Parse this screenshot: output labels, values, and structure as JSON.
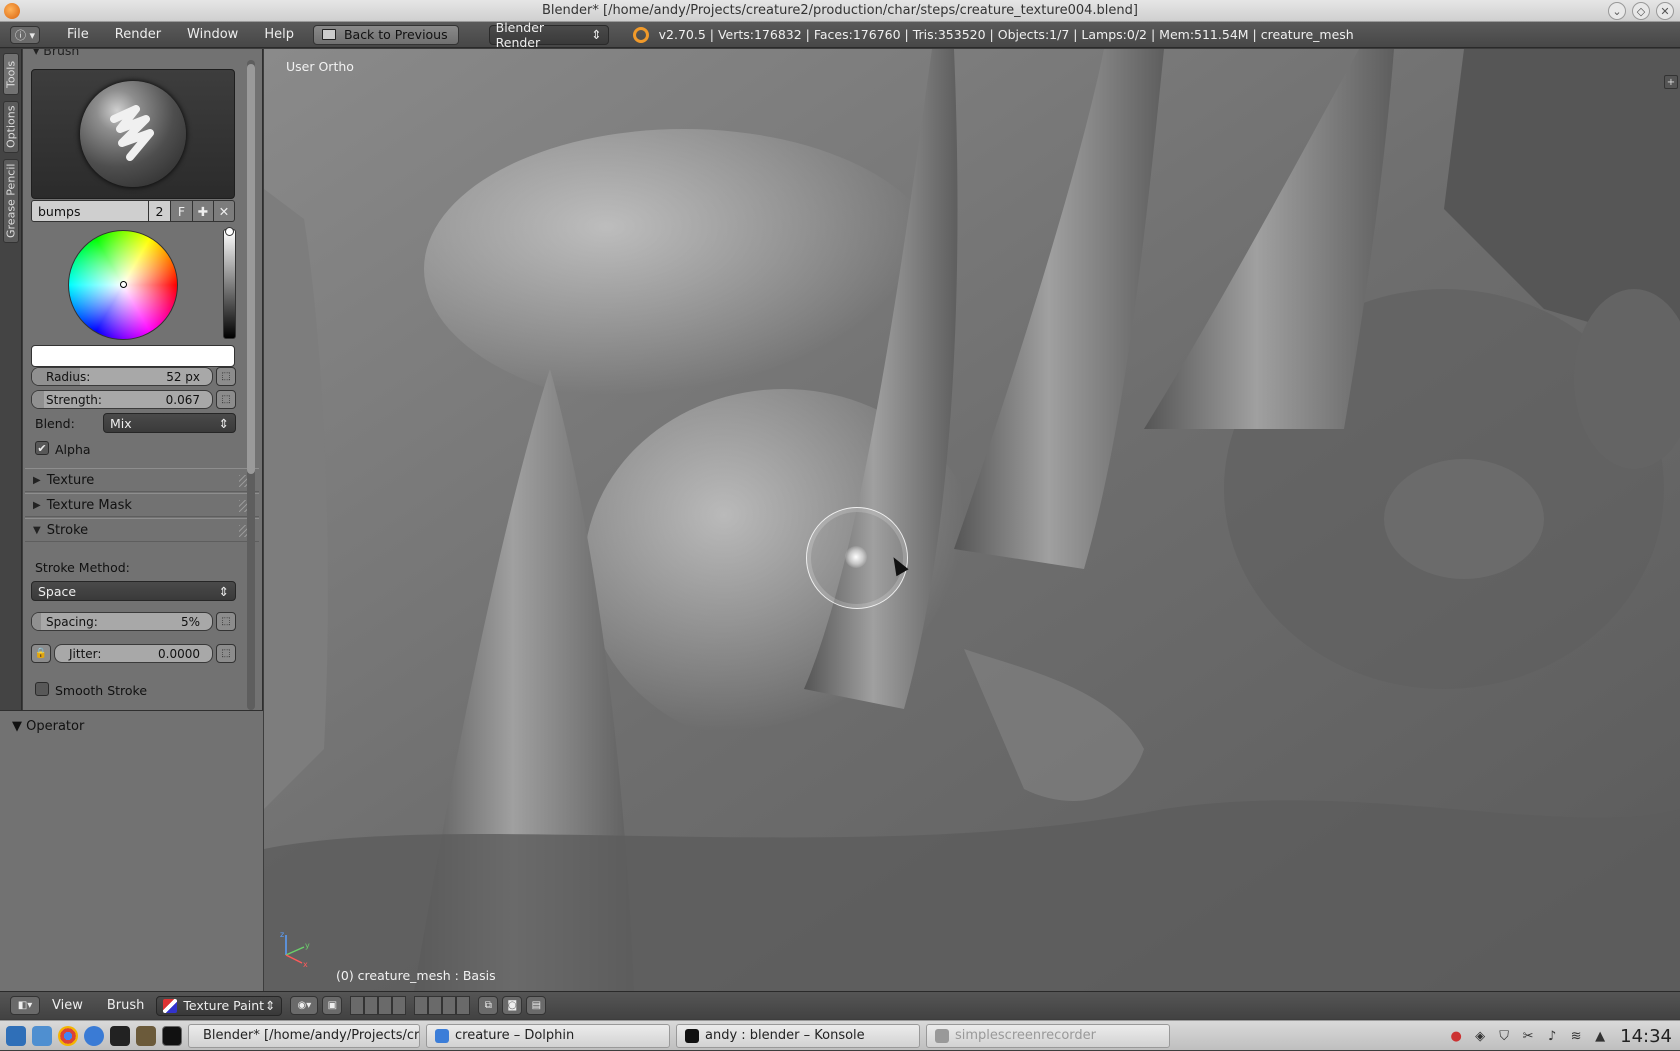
{
  "window": {
    "title": "Blender* [/home/andy/Projects/creature2/production/char/steps/creature_texture004.blend]"
  },
  "info_bar": {
    "menus": [
      "File",
      "Render",
      "Window",
      "Help"
    ],
    "back_button": "Back to Previous",
    "render_engine": "Blender Render",
    "stats": "v2.70.5 | Verts:176832 | Faces:176760 | Tris:353520 | Objects:1/7 | Lamps:0/2 | Mem:511.54M | creature_mesh"
  },
  "side_tabs": [
    "Tools",
    "Options",
    "Grease Pencil"
  ],
  "tool_panel": {
    "brush_header": "Brush",
    "brush_name": "bumps",
    "brush_users": "2",
    "fake_user": "F",
    "add_icon": "plus-icon",
    "delete_icon": "x-icon",
    "color": "#ffffff",
    "radius": {
      "label": "Radius:",
      "value": "52 px"
    },
    "strength": {
      "label": "Strength:",
      "value": "0.067",
      "fraction": 0.067
    },
    "blend": {
      "label": "Blend:",
      "value": "Mix"
    },
    "alpha": {
      "label": "Alpha",
      "checked": true
    },
    "sections": {
      "texture": "Texture",
      "texture_mask": "Texture Mask",
      "stroke": "Stroke"
    },
    "stroke": {
      "method_label": "Stroke Method:",
      "method_value": "Space",
      "spacing": {
        "label": "Spacing:",
        "value": "5%"
      },
      "jitter": {
        "label": "Jitter:",
        "value": "0.0000"
      },
      "smooth_stroke": {
        "label": "Smooth Stroke",
        "checked": false
      }
    }
  },
  "operator_panel": {
    "title": "Operator"
  },
  "viewport": {
    "view_label": "User Ortho",
    "object_label": "(0) creature_mesh : Basis"
  },
  "footer": {
    "menus": [
      "View",
      "Brush"
    ],
    "mode": "Texture Paint"
  },
  "taskbar": {
    "tasks": [
      "Blender* [/home/andy/Projects/cre",
      "creature – Dolphin",
      "andy : blender – Konsole",
      "simplescreenrecorder"
    ],
    "clock": "14:34"
  }
}
